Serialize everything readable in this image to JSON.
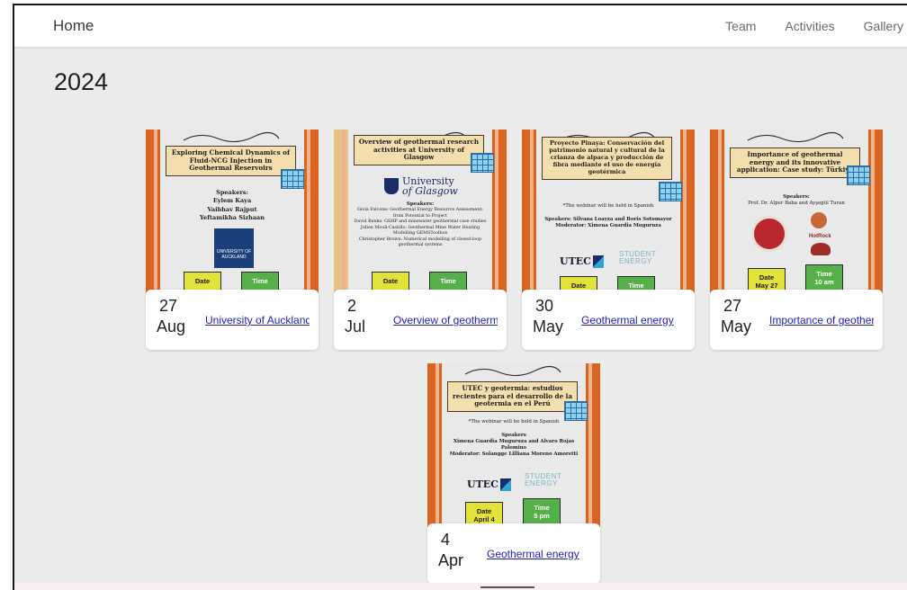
{
  "nav": {
    "home": "Home",
    "links": [
      "Team",
      "Activities",
      "Gallery"
    ]
  },
  "year": "2024",
  "events": [
    {
      "day": "27",
      "month": "Aug",
      "link_text": "University of Auckland",
      "poster": {
        "title": "Exploring Chemical Dynamics of Fluid-NCG Injection in Geothermal Reservoirs",
        "speakers_label": "Speakers:",
        "speakers": [
          "Eylem Kaya",
          "Vaibhav Rajput",
          "Yeftamikha Sizhaan"
        ],
        "logo_text": "UNIVERSITY OF AUCKLAND",
        "date_label": "Date",
        "time_label": "Time"
      }
    },
    {
      "day": "2",
      "month": "Jul",
      "link_text": "Overview of geothermal research",
      "poster": {
        "title": "Overview of geothermal research activities at University of Glasgow",
        "logo_line1": "University",
        "logo_line2": "of Glasgow",
        "speakers_label": "Speakers:",
        "lines": [
          "Gioia Falcone: Geothermal Energy Resource Assessment: from Potential to Project",
          "David Banks: GSHP and minewater geothermal case studies",
          "Julien Mouli-Castillo: Geothermal Mine Water Heating Modelling GEMSToolbox",
          "Christopher Brown: Numerical modelling of closed-loop geothermal systems"
        ],
        "date_label": "Date",
        "time_label": "Time"
      }
    },
    {
      "day": "30",
      "month": "May",
      "link_text": "Geothermal energy",
      "poster": {
        "title": "Proyecto Pinaya: Conservación del patrimonio natural y cultural de la crianza de alpaca y producción de fibra mediante el uso de energía geotérmica",
        "note": "*The webinar will be held in Spanish",
        "speakers": "Speakers: Silvana Loayza and Boris Sotomayor",
        "moderator": "Moderator: Ximena Guardia Muguruza",
        "logo_utec": "UTEC",
        "logo_se1": "STUDENT",
        "logo_se2": "ENERGY",
        "date_label": "Date",
        "time_label": "Time"
      }
    },
    {
      "day": "27",
      "month": "May",
      "link_text": "Importance of geothermal energy",
      "poster": {
        "title": "Importance of geothermal energy and its innovative application: Case study: Türkiye",
        "speakers_label": "Speakers:",
        "speakers": "Prof. Dr. Alper Baba and Ayşegül Turan",
        "logo_hotrock": "HotRock",
        "date_label": "Date",
        "date_value": "May 27",
        "time_label": "Time",
        "time_value": "10 am"
      }
    },
    {
      "day": "4",
      "month": "Apr",
      "link_text": "Geothermal energy",
      "poster": {
        "title": "UTEC y geotermia: estudios recientes para el desarrollo de la geotermia en el Perú",
        "note": "*The webinar will be held in Spanish",
        "speakers_label": "Speakers",
        "speakers": "Ximena Guardia Muguruza and Alvaro Rojas Palomino",
        "moderator": "Moderator: Solangge Lilliana Moreno Amoretti",
        "logo_utec": "UTEC",
        "logo_se1": "STUDENT",
        "logo_se2": "ENERGY",
        "date_label": "Date",
        "date_value": "April 4",
        "time_label": "Time",
        "time_value": "5 pm"
      }
    }
  ]
}
